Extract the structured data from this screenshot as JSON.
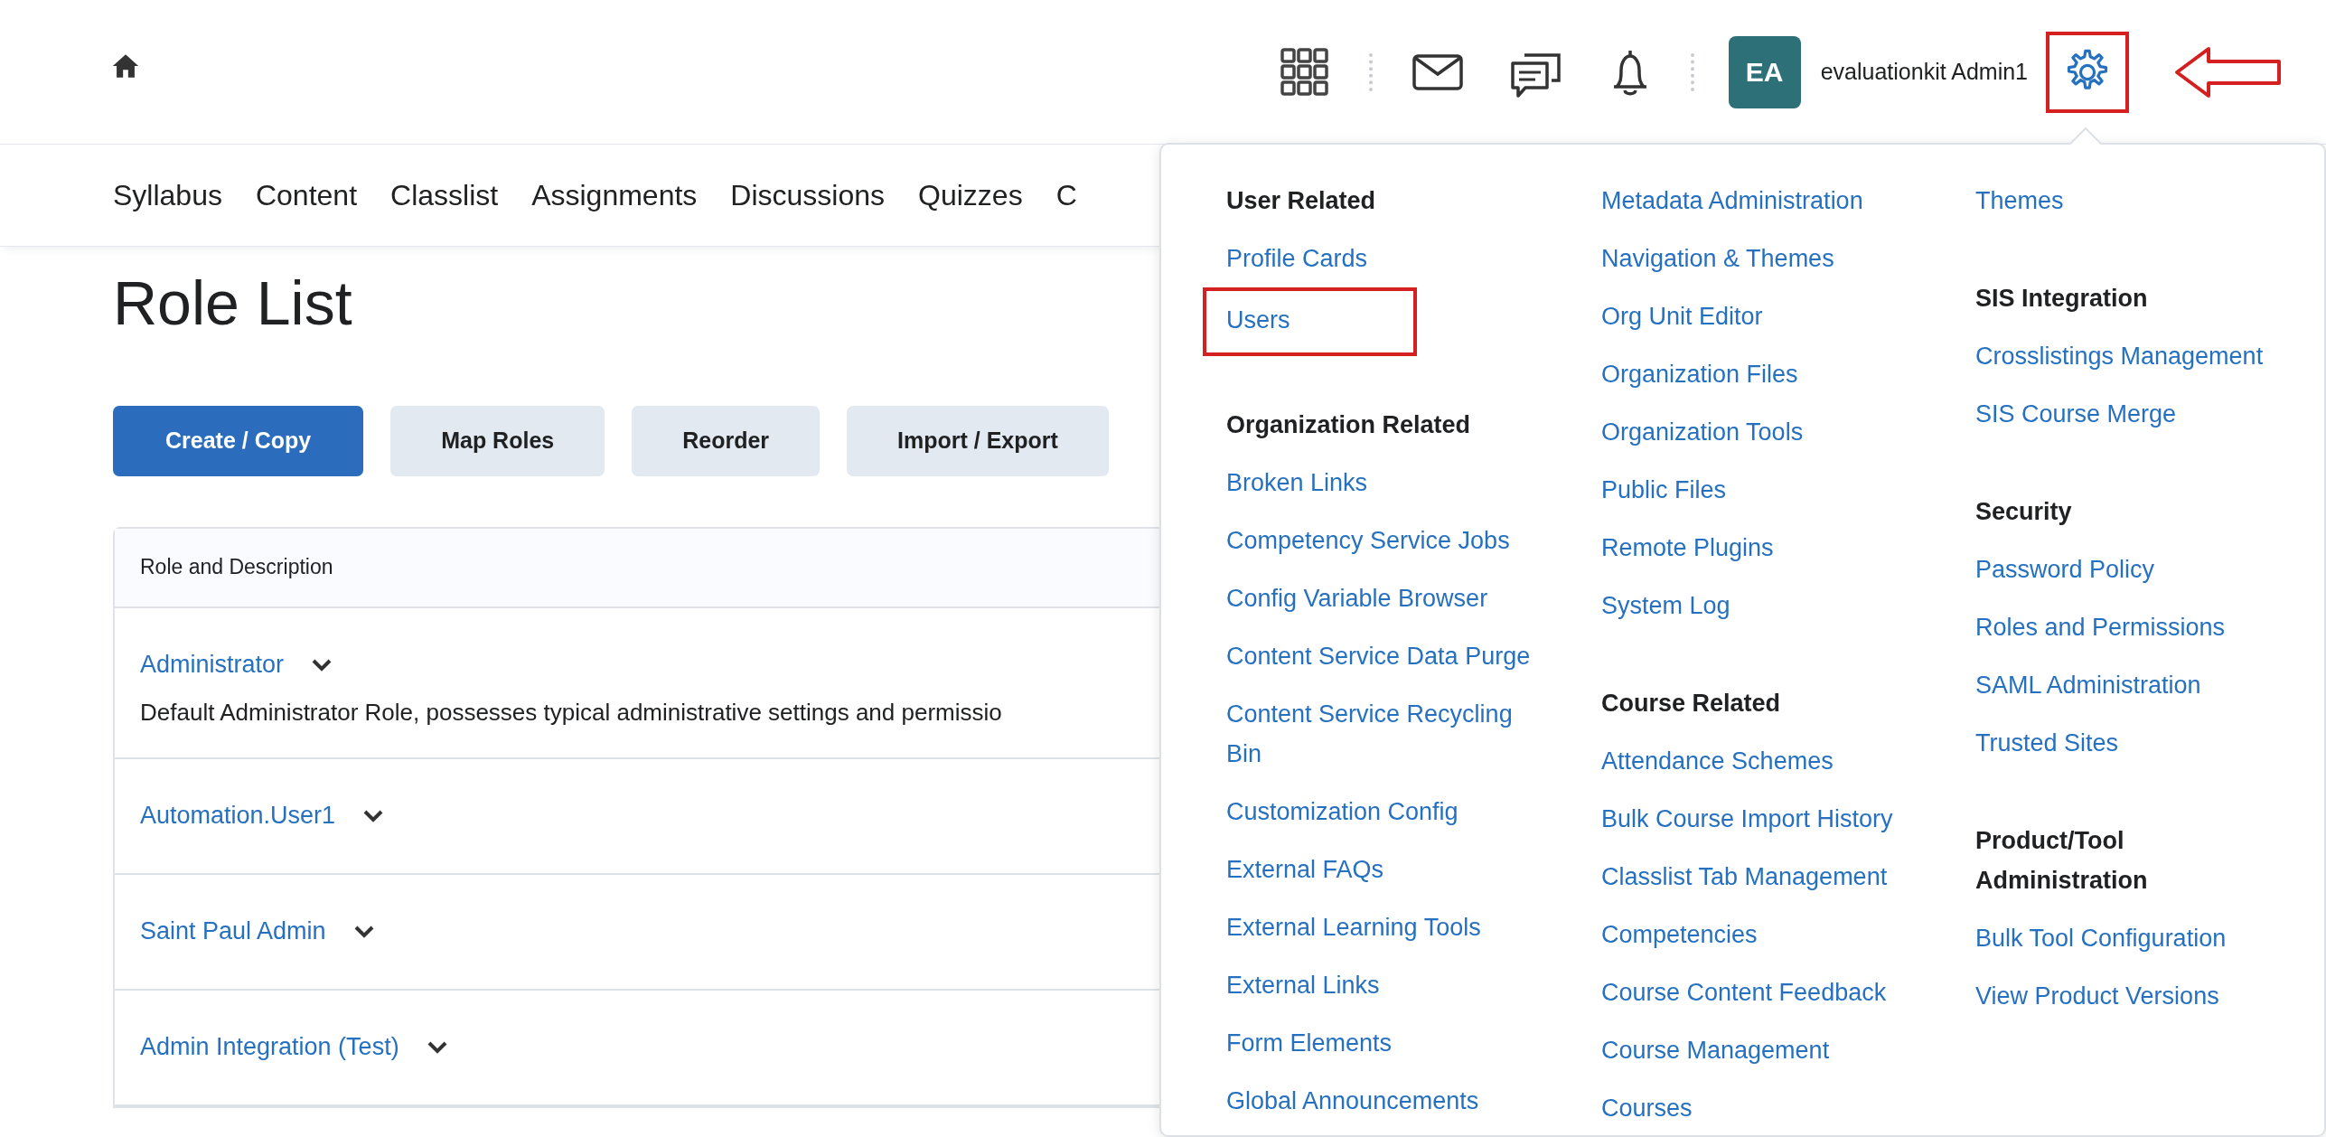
{
  "header": {
    "user": {
      "initials": "EA",
      "name": "evaluationkit Admin1"
    },
    "settings_button": {
      "annotated": true,
      "pointer_arrow": true
    }
  },
  "nav": {
    "items": [
      "Syllabus",
      "Content",
      "Classlist",
      "Assignments",
      "Discussions",
      "Quizzes",
      "C"
    ]
  },
  "page": {
    "title": "Role List",
    "buttons": [
      {
        "label": "Create / Copy",
        "primary": true
      },
      {
        "label": "Map Roles",
        "primary": false
      },
      {
        "label": "Reorder",
        "primary": false
      },
      {
        "label": "Import / Export",
        "primary": false
      }
    ],
    "table": {
      "column": "Role and Description",
      "rows": [
        {
          "role": "Administrator",
          "description": "Default Administrator Role, possesses typical administrative settings and permissio"
        },
        {
          "role": "Automation.User1"
        },
        {
          "role": "Saint Paul Admin"
        },
        {
          "role": "Admin Integration (Test)"
        }
      ]
    }
  },
  "admin_menu": {
    "columns": [
      [
        {
          "heading": "User Related",
          "links": [
            {
              "label": "Profile Cards",
              "annotated": false
            },
            {
              "label": "Users",
              "annotated": true
            }
          ]
        },
        {
          "heading": "Organization Related",
          "links": [
            {
              "label": "Broken Links",
              "annotated": false
            },
            {
              "label": "Competency Service Jobs",
              "annotated": false
            },
            {
              "label": "Config Variable Browser",
              "annotated": false
            },
            {
              "label": "Content Service Data Purge",
              "annotated": false
            },
            {
              "label": "Content Service Recycling Bin",
              "annotated": false
            },
            {
              "label": "Customization Config",
              "annotated": false
            },
            {
              "label": "External FAQs",
              "annotated": false
            },
            {
              "label": "External Learning Tools",
              "annotated": false
            },
            {
              "label": "External Links",
              "annotated": false
            },
            {
              "label": "Form Elements",
              "annotated": false
            },
            {
              "label": "Global Announcements",
              "annotated": false
            }
          ]
        }
      ],
      [
        {
          "links": [
            {
              "label": "Metadata Administration",
              "annotated": false
            },
            {
              "label": "Navigation & Themes",
              "annotated": false
            },
            {
              "label": "Org Unit Editor",
              "annotated": false
            },
            {
              "label": "Organization Files",
              "annotated": false
            },
            {
              "label": "Organization Tools",
              "annotated": false
            },
            {
              "label": "Public Files",
              "annotated": false
            },
            {
              "label": "Remote Plugins",
              "annotated": false
            },
            {
              "label": "System Log",
              "annotated": false
            }
          ]
        },
        {
          "heading": "Course Related",
          "links": [
            {
              "label": "Attendance Schemes",
              "annotated": false
            },
            {
              "label": "Bulk Course Import History",
              "annotated": false
            },
            {
              "label": "Classlist Tab Management",
              "annotated": false
            },
            {
              "label": "Competencies",
              "annotated": false
            },
            {
              "label": "Course Content Feedback",
              "annotated": false
            },
            {
              "label": "Course Management",
              "annotated": false
            },
            {
              "label": "Courses",
              "annotated": false
            }
          ]
        }
      ],
      [
        {
          "links": [
            {
              "label": "Themes",
              "annotated": false
            }
          ]
        },
        {
          "heading": "SIS Integration",
          "links": [
            {
              "label": "Crosslistings Management",
              "annotated": false
            },
            {
              "label": "SIS Course Merge",
              "annotated": false
            }
          ]
        },
        {
          "heading": "Security",
          "links": [
            {
              "label": "Password Policy",
              "annotated": false
            },
            {
              "label": "Roles and Permissions",
              "annotated": false
            },
            {
              "label": "SAML Administration",
              "annotated": false
            },
            {
              "label": "Trusted Sites",
              "annotated": false
            }
          ]
        },
        {
          "heading": "Product/Tool Administration",
          "links": [
            {
              "label": "Bulk Tool Configuration",
              "annotated": false
            },
            {
              "label": "View Product Versions",
              "annotated": false
            }
          ]
        }
      ]
    ]
  }
}
